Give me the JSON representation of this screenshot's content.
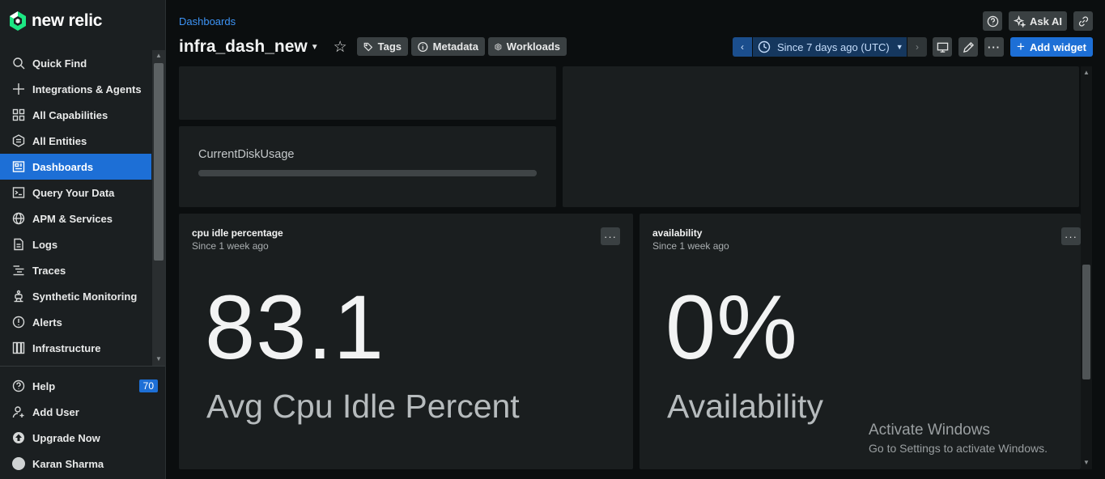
{
  "app": {
    "brand": "new relic",
    "accent_color": "#1d6fd6"
  },
  "sidebar": {
    "items": [
      {
        "label": "Quick Find",
        "icon": "search-icon"
      },
      {
        "label": "Integrations & Agents",
        "icon": "plus-icon"
      },
      {
        "label": "All Capabilities",
        "icon": "grid-icon"
      },
      {
        "label": "All Entities",
        "icon": "entities-icon"
      },
      {
        "label": "Dashboards",
        "icon": "dashboard-icon",
        "active": true
      },
      {
        "label": "Query Your Data",
        "icon": "terminal-icon"
      },
      {
        "label": "APM & Services",
        "icon": "globe-icon"
      },
      {
        "label": "Logs",
        "icon": "document-icon"
      },
      {
        "label": "Traces",
        "icon": "traces-icon"
      },
      {
        "label": "Synthetic Monitoring",
        "icon": "robot-icon"
      },
      {
        "label": "Alerts",
        "icon": "alert-icon"
      },
      {
        "label": "Infrastructure",
        "icon": "infrastructure-icon"
      }
    ],
    "bottom": {
      "help_label": "Help",
      "help_badge": "70",
      "add_user_label": "Add User",
      "upgrade_label": "Upgrade Now",
      "user_name": "Karan Sharma"
    }
  },
  "header": {
    "breadcrumb": "Dashboards",
    "title": "infra_dash_new",
    "chips": {
      "tags": "Tags",
      "metadata": "Metadata",
      "workloads": "Workloads"
    },
    "ask_ai": "Ask AI",
    "time_range": "Since 7 days ago (UTC)",
    "add_widget": "Add widget"
  },
  "widgets": {
    "disk": {
      "label": "CurrentDiskUsage"
    },
    "cpu": {
      "title": "cpu idle percentage",
      "subtitle": "Since 1 week ago",
      "value": "83.1",
      "label": "Avg Cpu Idle Percent"
    },
    "availability": {
      "title": "availability",
      "subtitle": "Since 1 week ago",
      "value": "0%",
      "label": "Availability"
    }
  },
  "watermark": {
    "title": "Activate Windows",
    "subtitle": "Go to Settings to activate Windows."
  }
}
